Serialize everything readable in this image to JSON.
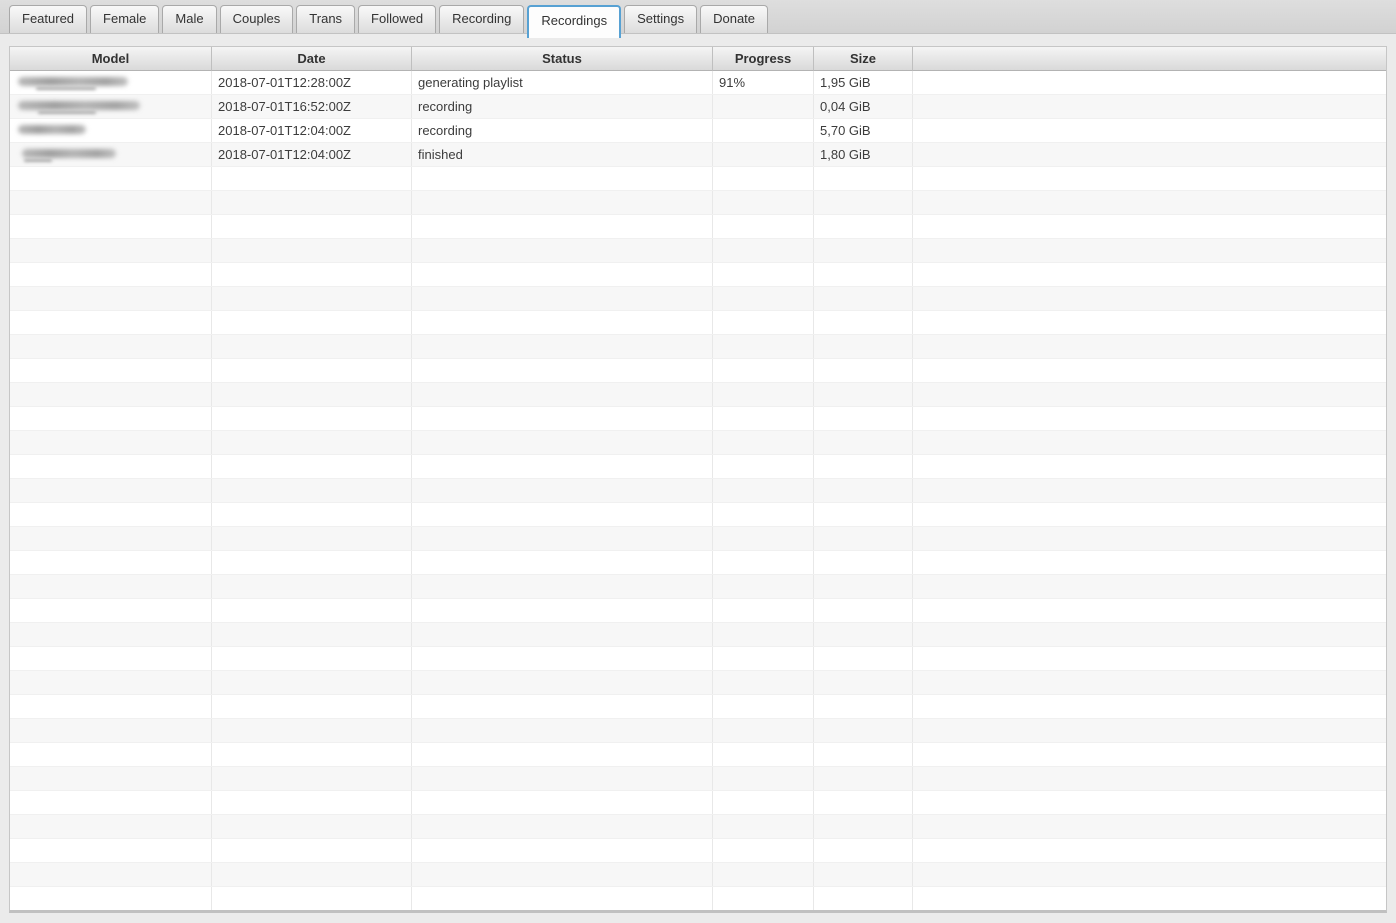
{
  "tabs": [
    {
      "label": "Featured",
      "active": false
    },
    {
      "label": "Female",
      "active": false
    },
    {
      "label": "Male",
      "active": false
    },
    {
      "label": "Couples",
      "active": false
    },
    {
      "label": "Trans",
      "active": false
    },
    {
      "label": "Followed",
      "active": false
    },
    {
      "label": "Recording",
      "active": false
    },
    {
      "label": "Recordings",
      "active": true
    },
    {
      "label": "Settings",
      "active": false
    },
    {
      "label": "Donate",
      "active": false
    }
  ],
  "table": {
    "columns": [
      {
        "label": "Model"
      },
      {
        "label": "Date"
      },
      {
        "label": "Status"
      },
      {
        "label": "Progress"
      },
      {
        "label": "Size"
      },
      {
        "label": ""
      }
    ],
    "rows": [
      {
        "model_redacted": true,
        "blur_main": "width:110px",
        "blur_dash": "left:20px;width:60px",
        "date": "2018-07-01T12:28:00Z",
        "status": "generating playlist",
        "progress": "91%",
        "size": "1,95 GiB"
      },
      {
        "model_redacted": true,
        "blur_main": "width:122px",
        "blur_dash": "left:22px;width:58px",
        "date": "2018-07-01T16:52:00Z",
        "status": "recording",
        "progress": "",
        "size": "0,04 GiB"
      },
      {
        "model_redacted": true,
        "blur_main": "width:68px",
        "blur_dash": "left:0;width:0",
        "date": "2018-07-01T12:04:00Z",
        "status": "recording",
        "progress": "",
        "size": "5,70 GiB"
      },
      {
        "model_redacted": true,
        "blur_main": "left:6px;width:94px",
        "blur_dash": "left:8px;width:28px",
        "date": "2018-07-01T12:04:00Z",
        "status": "finished",
        "progress": "",
        "size": "1,80 GiB"
      }
    ],
    "empty_row_count": 31
  },
  "colors": {
    "accent_tab_border": "#57a1d3",
    "tabbar_background": "#d6d6d6",
    "content_background": "#ebebeb",
    "header_gradient_top": "#f5f5f5",
    "header_gradient_bottom": "#d9d9d9",
    "row_stripe": "#f7f7f7",
    "text": "#3c3c3c"
  }
}
